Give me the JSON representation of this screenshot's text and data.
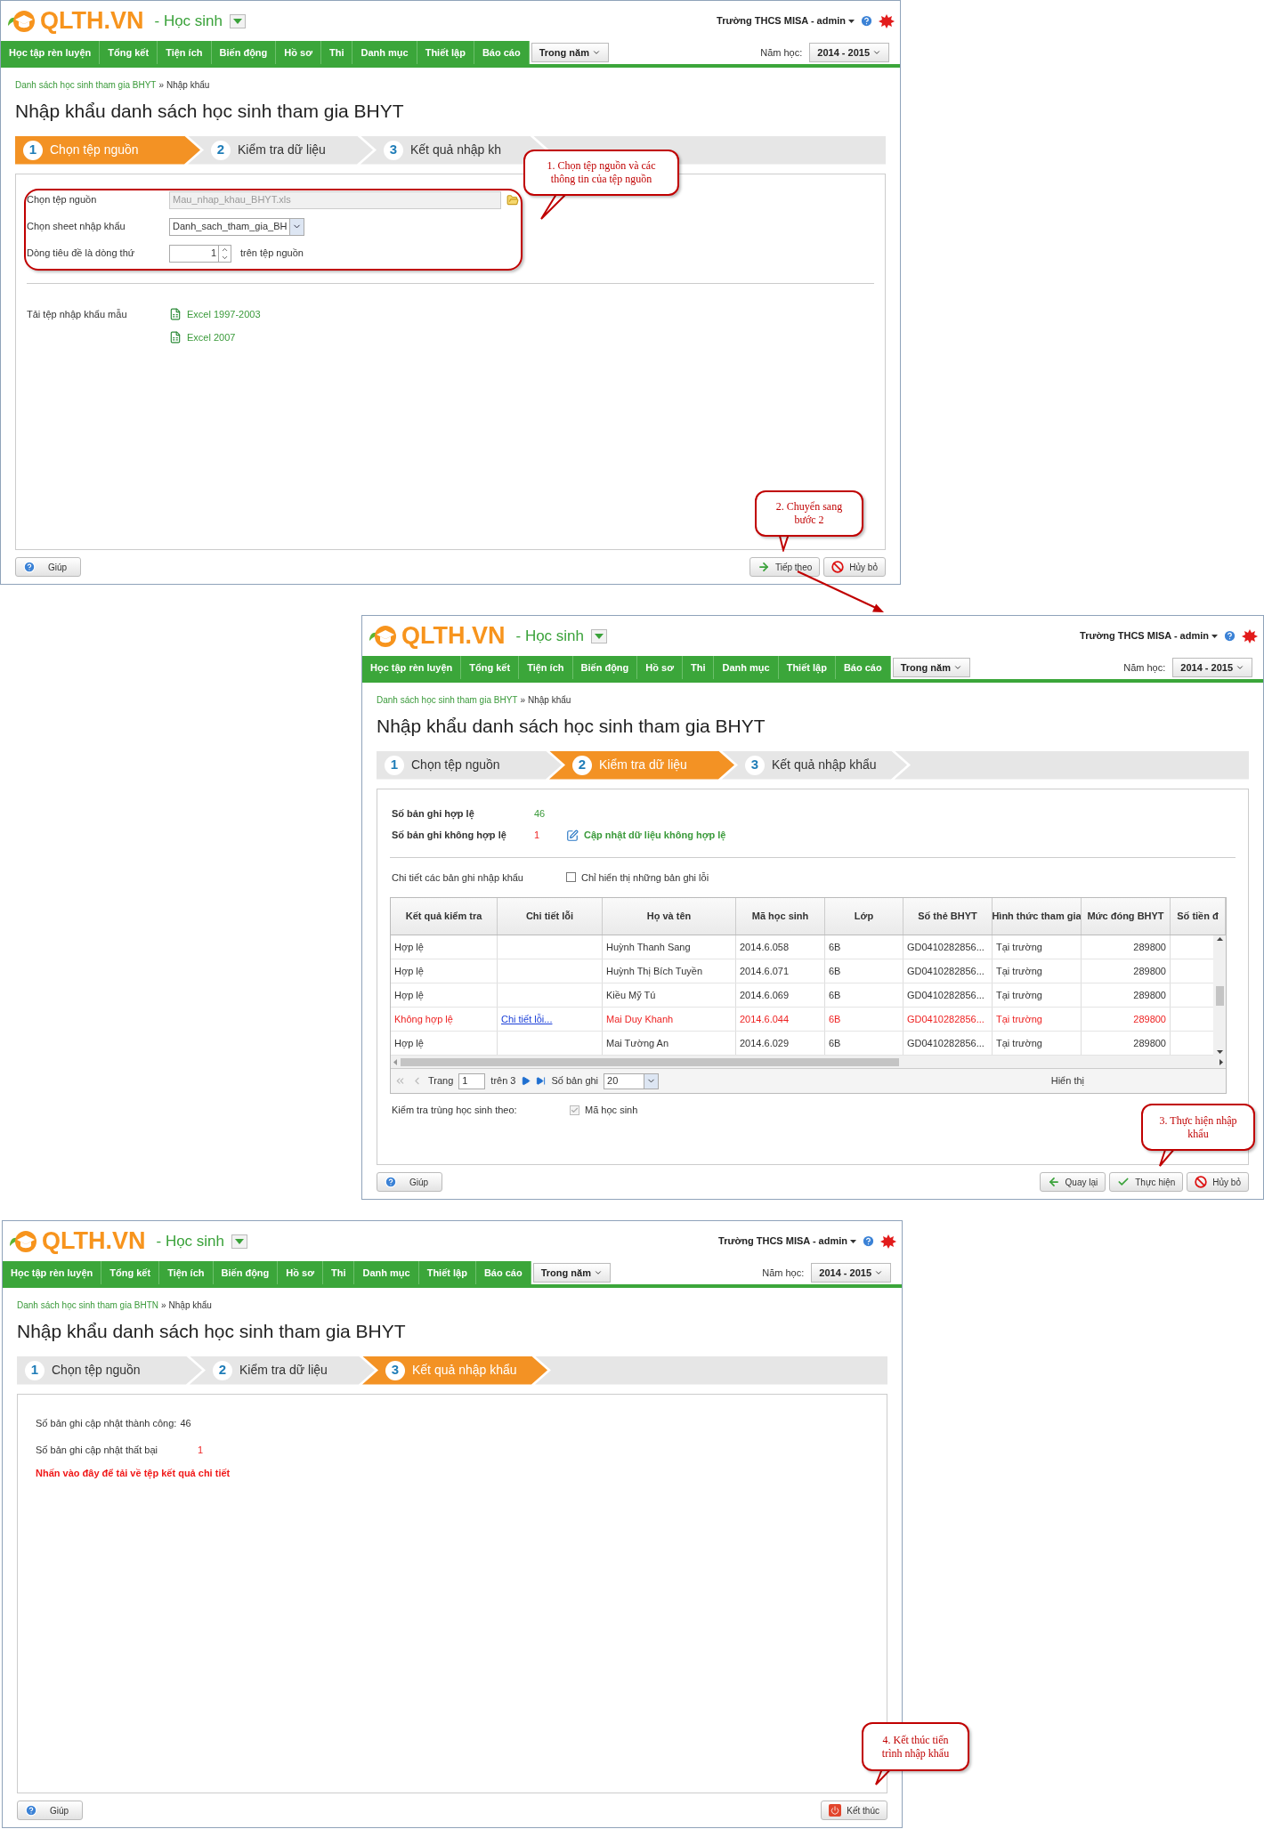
{
  "screens": [
    {
      "kind": "source",
      "header": {
        "logo": "QLTH.VN",
        "module": "- Học sinh",
        "account": "Trường THCS MISA - admin",
        "nav": [
          "Học tập rèn luyện",
          "Tổng kết",
          "Tiện ích",
          "Biến động",
          "Hồ sơ",
          "Thi",
          "Danh mục",
          "Thiết lập",
          "Báo cáo"
        ],
        "period": "Trong năm",
        "year_label": "Năm học:",
        "year": "2014 - 2015"
      },
      "breadcrumb": {
        "link": "Danh sách học sinh tham gia BHYT",
        "separator": "»",
        "current": "Nhập khẩu"
      },
      "title": "Nhập khẩu danh sách học sinh tham gia BHYT",
      "steps": [
        {
          "number": "1",
          "label": "Chọn tệp nguồn",
          "selected": true
        },
        {
          "number": "2",
          "label": "Kiểm tra dữ liệu",
          "selected": false
        },
        {
          "number": "3",
          "label": "Kết quả nhập kh",
          "selected": false
        }
      ],
      "body": {
        "fields": [
          {
            "kind": "file",
            "label": "Chọn tệp nguồn",
            "value": "Mau_nhap_khau_BHYT.xls"
          },
          {
            "kind": "select",
            "label": "Chọn sheet nhập khẩu",
            "value": "Danh_sach_tham_gia_BH"
          },
          {
            "kind": "spinner",
            "label": "Dòng tiêu đề là dòng thứ",
            "value": "1",
            "suffix": "trên tệp nguồn"
          }
        ],
        "templates": {
          "label": "Tải tệp nhập khẩu mẫu",
          "links": [
            "Excel 1997-2003",
            "Excel 2007"
          ]
        }
      },
      "buttons": [
        {
          "kind": "help",
          "label": "Giúp"
        },
        {
          "kind": "next",
          "label": "Tiếp theo"
        },
        {
          "kind": "cancel",
          "label": "Hủy bỏ"
        }
      ],
      "callout": "1. Chọn tệp nguồn và các thông tin của tệp nguồn"
    },
    {
      "kind": "check",
      "header": {
        "logo": "QLTH.VN",
        "module": "- Học sinh",
        "account": "Trường THCS MISA - admin",
        "nav": [
          "Học tập rèn luyện",
          "Tổng kết",
          "Tiện ích",
          "Biến động",
          "Hồ sơ",
          "Thi",
          "Danh mục",
          "Thiết lập",
          "Báo cáo"
        ],
        "period": "Trong năm",
        "year_label": "Năm học:",
        "year": "2014 - 2015"
      },
      "breadcrumb": {
        "link": "Danh sách học sinh tham gia BHYT",
        "separator": "»",
        "current": "Nhập khẩu"
      },
      "title": "Nhập khẩu danh sách học sinh tham gia BHYT",
      "steps": [
        {
          "number": "1",
          "label": "Chọn tệp nguồn",
          "selected": false
        },
        {
          "number": "2",
          "label": "Kiểm tra dữ liệu",
          "selected": true
        },
        {
          "number": "3",
          "label": "Kết quả nhập khẩu",
          "selected": false
        }
      ],
      "body": {
        "valid": {
          "label": "Số bản ghi hợp lệ",
          "value": "46"
        },
        "invalid": {
          "label": "Số bản ghi không hợp lệ",
          "value": "1",
          "link": "Cập nhật dữ liệu không hợp lệ"
        },
        "detail_label": "Chi tiết các bản ghi nhập khẩu",
        "filter": {
          "label": "Chỉ hiển thị những bản ghi lỗi",
          "checked": false
        },
        "table": {
          "columns": [
            "Kết quả kiểm tra",
            "Chi tiết lỗi",
            "Họ và tên",
            "Mã học sinh",
            "Lớp",
            "Số thẻ BHYT",
            "Hình thức tham gia",
            "Mức đóng BHYT",
            "Số tiền đ"
          ],
          "rows": [
            {
              "valid": true,
              "result": "Hợp lệ",
              "name": "Huỳnh Thanh Sang",
              "code": "2014.6.058",
              "class": "6B",
              "card": "GD0410282856...",
              "mode": "Tại trường",
              "fee": "289800"
            },
            {
              "valid": true,
              "result": "Hợp lệ",
              "name": "Huỳnh Thị Bích Tuyền",
              "code": "2014.6.071",
              "class": "6B",
              "card": "GD0410282856...",
              "mode": "Tại trường",
              "fee": "289800"
            },
            {
              "valid": true,
              "result": "Hợp lệ",
              "name": "Kiều Mỹ Tú",
              "code": "2014.6.069",
              "class": "6B",
              "card": "GD0410282856...",
              "mode": "Tại trường",
              "fee": "289800"
            },
            {
              "valid": false,
              "result": "Không hợp lệ",
              "error": "Chi tiết lỗi...",
              "name": "Mai Duy Khanh",
              "code": "2014.6.044",
              "class": "6B",
              "card": "GD0410282856...",
              "mode": "Tại trường",
              "fee": "289800"
            },
            {
              "valid": true,
              "result": "Hợp lệ",
              "name": "Mai Tường An",
              "code": "2014.6.029",
              "class": "6B",
              "card": "GD0410282856...",
              "mode": "Tại trường",
              "fee": "289800"
            }
          ]
        },
        "pager": {
          "page_label": "Trang",
          "page": "1",
          "of": "trên 3",
          "size_label": "Số bản ghi",
          "size": "20",
          "info": "Hiển thị"
        },
        "duplicate": {
          "label": "Kiểm tra trùng học sinh theo:",
          "option": "Mã học sinh",
          "checked": true
        }
      },
      "buttons": [
        {
          "kind": "help",
          "label": "Giúp"
        },
        {
          "kind": "back",
          "label": "Quay lại"
        },
        {
          "kind": "run",
          "label": "Thực hiện"
        },
        {
          "kind": "cancel",
          "label": "Hủy bỏ"
        }
      ],
      "callout": "3. Thực hiện nhập khẩu"
    },
    {
      "kind": "result",
      "header": {
        "logo": "QLTH.VN",
        "module": "- Học sinh",
        "account": "Trường THCS MISA - admin",
        "nav": [
          "Học tập rèn luyện",
          "Tổng kết",
          "Tiện ích",
          "Biến động",
          "Hồ sơ",
          "Thi",
          "Danh mục",
          "Thiết lập",
          "Báo cáo"
        ],
        "period": "Trong năm",
        "year_label": "Năm học:",
        "year": "2014 - 2015"
      },
      "breadcrumb": {
        "link": "Danh sách học sinh tham gia BHTN",
        "separator": "»",
        "current": "Nhập khẩu"
      },
      "title": "Nhập khẩu danh sách học sinh tham gia BHYT",
      "steps": [
        {
          "number": "1",
          "label": "Chọn tệp nguồn",
          "selected": false
        },
        {
          "number": "2",
          "label": "Kiểm tra dữ liệu",
          "selected": false
        },
        {
          "number": "3",
          "label": "Kết quả nhập khẩu",
          "selected": true
        }
      ],
      "body": {
        "success": {
          "label": "Số bản ghi cập nhật thành công:",
          "value": "46"
        },
        "failed": {
          "label": "Số bản ghi cập nhật thất bại",
          "value": "1"
        },
        "download": "Nhấn vào đây để tải về tệp kết quả chi tiết"
      },
      "buttons": [
        {
          "kind": "help",
          "label": "Giúp"
        },
        {
          "kind": "finish",
          "label": "Kết thúc"
        }
      ],
      "callout": "4. Kết thúc tiến trình nhập khẩu"
    }
  ],
  "step_callout": "2. Chuyển sang bước 2"
}
